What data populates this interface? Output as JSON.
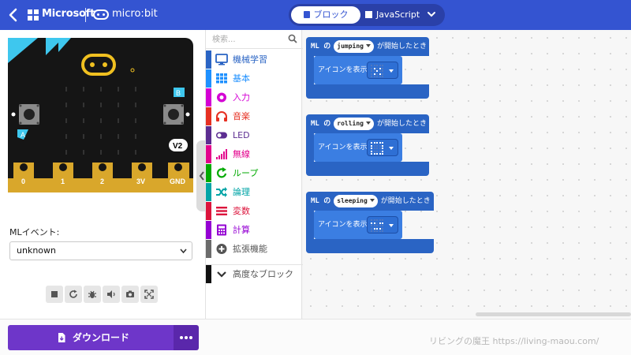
{
  "header": {
    "brand": "Microsoft",
    "product": "micro:bit",
    "icons": {
      "back": "chevron-left-icon",
      "brand": "microsoft-logo-icon",
      "product": "microbit-logo-icon"
    },
    "editor_modes": {
      "blocks": "ブロック",
      "javascript": "JavaScript",
      "active": "blocks"
    }
  },
  "simulator": {
    "board_label": "V2",
    "buttons": [
      "A",
      "B"
    ],
    "pins": [
      "0",
      "1",
      "2",
      "3V",
      "GND"
    ],
    "ml_event_label": "MLイベント:",
    "ml_event_value": "unknown",
    "toolbar_icons": [
      "stop-icon",
      "restart-icon",
      "debug-icon",
      "mute-icon",
      "screenshot-icon",
      "fullscreen-icon"
    ]
  },
  "toolbox": {
    "search_placeholder": "検索...",
    "categories": [
      {
        "label": "機械学習",
        "color": "#2a64c4",
        "icon": "monitor-icon"
      },
      {
        "label": "基本",
        "color": "#1e90ff",
        "icon": "grid-icon"
      },
      {
        "label": "入力",
        "color": "#d400d4",
        "icon": "target-icon"
      },
      {
        "label": "音楽",
        "color": "#e63022",
        "icon": "headphones-icon"
      },
      {
        "label": "LED",
        "color": "#5c2d91",
        "icon": "toggle-icon"
      },
      {
        "label": "無線",
        "color": "#e3008c",
        "icon": "signal-bars-icon"
      },
      {
        "label": "ループ",
        "color": "#00aa00",
        "icon": "loop-icon"
      },
      {
        "label": "論理",
        "color": "#00a4a6",
        "icon": "shuffle-icon"
      },
      {
        "label": "変数",
        "color": "#dc143c",
        "icon": "lines-icon"
      },
      {
        "label": "計算",
        "color": "#9400d3",
        "icon": "calculator-icon"
      },
      {
        "label": "拡張機能",
        "color": "#6b6b6b",
        "icon": "plus-circle-icon"
      }
    ],
    "advanced": {
      "label": "高度なブロック",
      "icon": "chevron-down-icon"
    }
  },
  "workspace": {
    "events": [
      {
        "prefix": "ML の",
        "gesture": "jumping",
        "suffix": "が開始したとき",
        "statement": "アイコンを表示",
        "leds": [
          0,
          0,
          0,
          0,
          0,
          0,
          1,
          0,
          1,
          0,
          0,
          0,
          1,
          0,
          0,
          0,
          1,
          0,
          1,
          0,
          0,
          0,
          0,
          0,
          0
        ]
      },
      {
        "prefix": "ML の",
        "gesture": "rolling",
        "suffix": "が開始したとき",
        "statement": "アイコンを表示",
        "leds": [
          1,
          1,
          1,
          1,
          1,
          1,
          0,
          0,
          0,
          1,
          1,
          0,
          0,
          0,
          1,
          1,
          0,
          0,
          0,
          1,
          1,
          1,
          1,
          1,
          1
        ]
      },
      {
        "prefix": "ML の",
        "gesture": "sleeping",
        "suffix": "が開始したとき",
        "statement": "アイコンを表示",
        "leds": [
          0,
          0,
          0,
          0,
          0,
          1,
          1,
          0,
          1,
          1,
          0,
          0,
          0,
          0,
          0,
          0,
          1,
          1,
          1,
          0,
          0,
          0,
          0,
          0,
          0
        ]
      }
    ]
  },
  "footer": {
    "download_label": "ダウンロード",
    "download_icon": "download-file-icon",
    "more_icon": "ellipsis-icon",
    "watermark": "リビングの魔王 https://living-maou.com/"
  }
}
